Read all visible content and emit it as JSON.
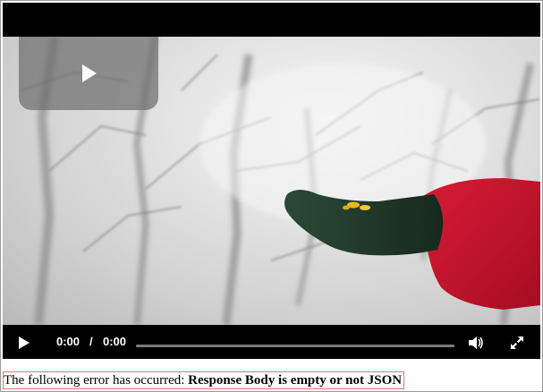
{
  "player": {
    "current_time": "0:00",
    "time_separator": "/",
    "duration": "0:00",
    "progress": 0,
    "icons": {
      "big_play": "play-icon",
      "play": "play-icon",
      "volume": "volume-icon",
      "fullscreen": "fullscreen-icon"
    }
  },
  "error": {
    "prefix": "The following error has occurred:",
    "message": "Response Body is empty or not JSON"
  },
  "colors": {
    "controls_bg": "#000000",
    "error_border": "#e0756f",
    "sleeve": "#c8102e",
    "glove": "#1f3a2a"
  }
}
